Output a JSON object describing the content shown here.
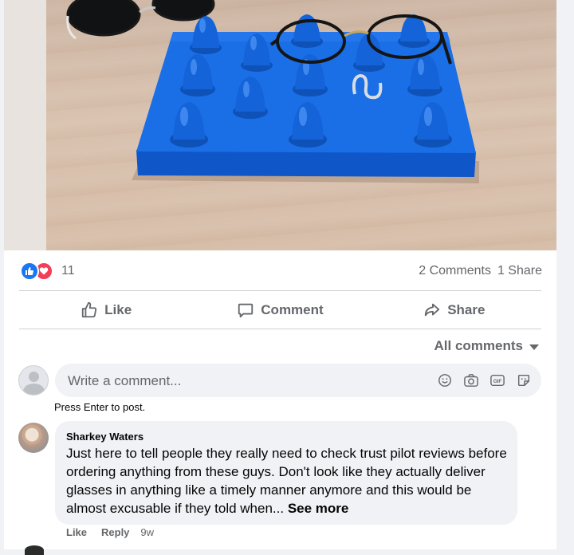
{
  "post": {
    "reaction_count": "11",
    "comments_count": "2 Comments",
    "shares_count": "1 Share"
  },
  "actions": {
    "like": "Like",
    "comment": "Comment",
    "share": "Share"
  },
  "comments_filter": "All comments",
  "composer": {
    "placeholder": "Write a comment...",
    "hint": "Press Enter to post.",
    "icons": [
      "emoji-icon",
      "camera-icon",
      "gif-icon",
      "sticker-icon"
    ]
  },
  "comments": [
    {
      "author": "Sharkey Waters",
      "text": "Just here to tell people they really need to check trust pilot reviews before ordering anything from these guys. Don't look like they actually deliver glasses in anything like a timely manner anymore and this would be almost excusable if they told when...",
      "see_more": "See more",
      "like_label": "Like",
      "reply_label": "Reply",
      "time": "9w"
    }
  ],
  "colors": {
    "accent": "#1877f2",
    "love": "#f33e58",
    "secondary_text": "#65676b",
    "bubble_bg": "#f0f2f5",
    "tray_blue": "#1565d8"
  }
}
